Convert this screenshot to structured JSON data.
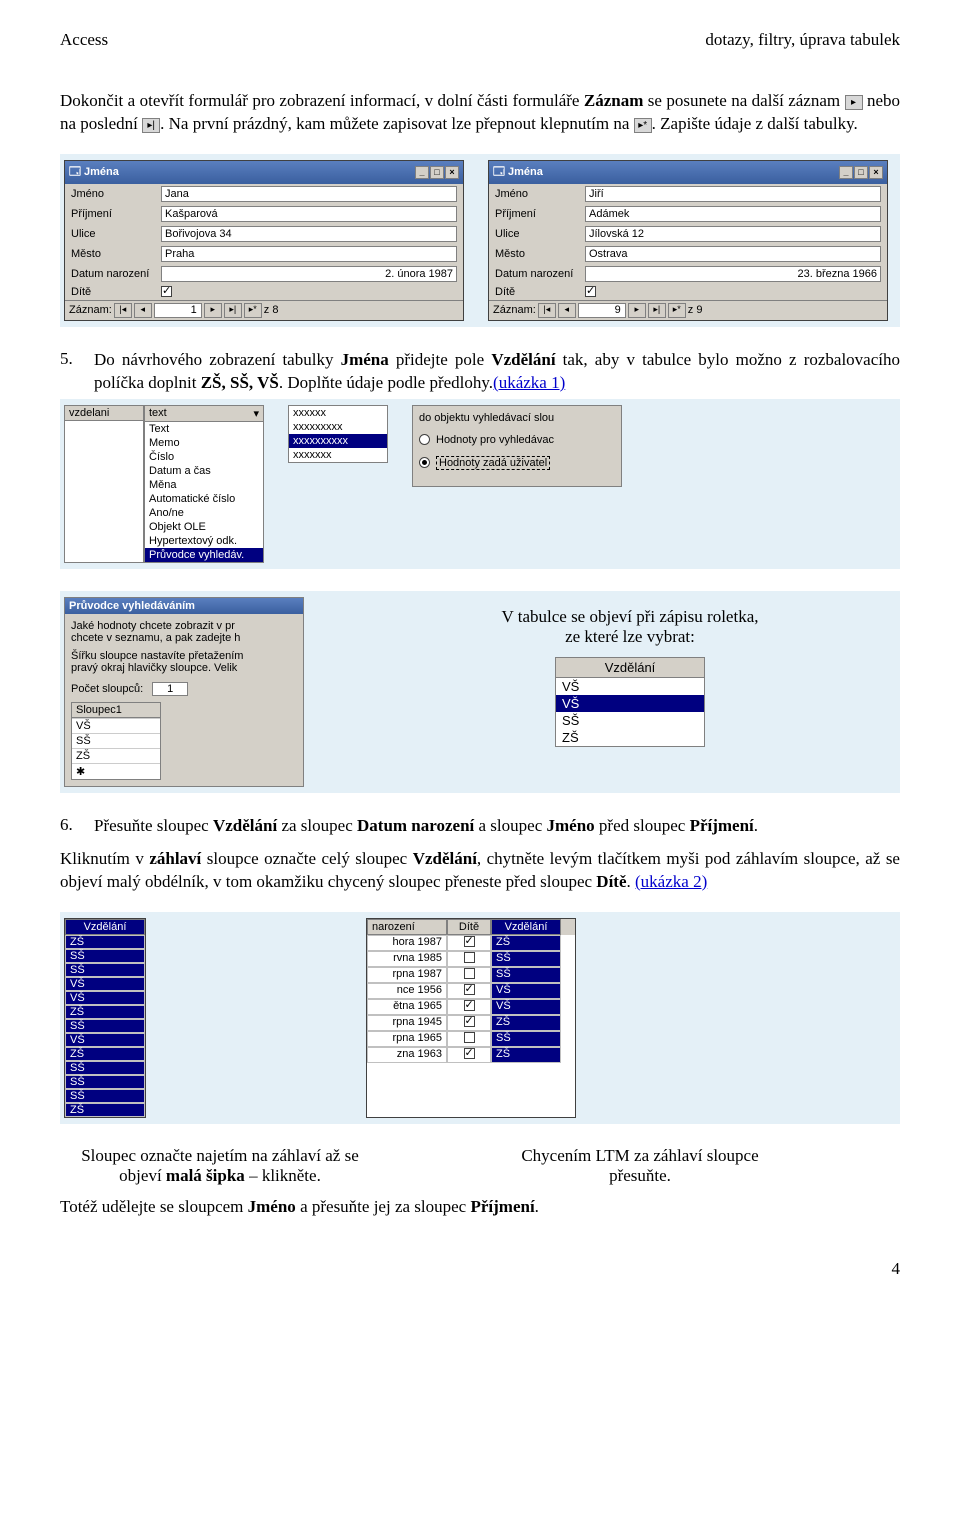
{
  "header": {
    "left": "Access",
    "right": "dotazy, filtry, úprava tabulek"
  },
  "intro": {
    "p1a": "Dokončit a otevřít formulář pro zobrazení informací, v dolní části formuláře ",
    "p1b": "Záznam",
    "p1c": " se posunete na další záznam ",
    "p1d": " nebo na poslední ",
    "p1e": ". Na první prázdný, kam můžete zapisovat lze přepnout klepnutím na ",
    "p1f": ". Zapište údaje z další tabulky."
  },
  "icons": {
    "next": "▸",
    "last": "▸|",
    "new": "▸*"
  },
  "forms": {
    "title": "Jména",
    "labels": {
      "jmeno": "Jméno",
      "prijmeni": "Příjmení",
      "ulice": "Ulice",
      "mesto": "Město",
      "datum": "Datum narození",
      "dite": "Dítě"
    },
    "left": {
      "jmeno": "Jana",
      "prijmeni": "Kašparová",
      "ulice": "Bořivojova 34",
      "mesto": "Praha",
      "datum": "2. února 1987",
      "rec": "1",
      "total": "z 8"
    },
    "right": {
      "jmeno": "Jiří",
      "prijmeni": "Adámek",
      "ulice": "Jílovská 12",
      "mesto": "Ostrava",
      "datum": "23. března 1966",
      "rec": "9",
      "total": "z 9"
    },
    "recnav_label": "Záznam:"
  },
  "task5": {
    "num": "5.",
    "text_a": "Do návrhového zobrazení tabulky ",
    "text_b": "Jména",
    "text_c": " přidejte pole ",
    "text_d": "Vzdělání",
    "text_e": " tak, aby v tabulce bylo možno z rozbalovacího políčka doplnit ",
    "text_f": "ZŠ, SŠ, VŠ",
    "text_g": ". Doplňte údaje podle předlohy.",
    "link": "(ukázka 1)"
  },
  "design": {
    "field": "vzdelani",
    "type": "text",
    "types": [
      "Text",
      "Memo",
      "Číslo",
      "Datum a čas",
      "Měna",
      "Automatické číslo",
      "Ano/ne",
      "Objekt OLE",
      "Hypertextový odk.",
      "Průvodce vyhledáv."
    ],
    "type_selected": "Průvodce vyhledáv."
  },
  "lookup_box": {
    "rows": [
      "xxxxxx",
      "xxxxxxxxx",
      "xxxxxxxxxx",
      "xxxxxxx"
    ],
    "selected": "xxxxxxxxxx"
  },
  "radio": {
    "head": "do objektu vyhledávací slou",
    "opt1": "Hodnoty pro vyhledávac",
    "opt2": "Hodnoty zadá uživatel"
  },
  "wizard": {
    "title": "Průvodce vyhledáváním",
    "l1": "Jaké hodnoty chcete zobrazit v pr",
    "l2": "chcete v seznamu, a pak zadejte h",
    "l3": "Šířku sloupce nastavíte přetažením",
    "l4": "pravý okraj hlavičky sloupce. Velik",
    "cols_label": "Počet sloupců:",
    "cols_val": "1",
    "col_head": "Sloupec1",
    "col_rows": [
      "VŠ",
      "SŠ",
      "ZŠ"
    ]
  },
  "roletka_caption_a": "V tabulce se objeví při zápisu roletka,",
  "roletka_caption_b": "ze které lze vybrat:",
  "roletka": {
    "head": "Vzdělání",
    "opts": [
      "VŠ",
      "VŠ",
      "SŠ",
      "ZŠ"
    ],
    "selected": 1
  },
  "task6": {
    "num": "6.",
    "a": "Přesuňte sloupec ",
    "b": "Vzdělání",
    "c": " za sloupec ",
    "d": "Datum narození",
    "e": " a sloupec ",
    "f": "Jméno",
    "g": " před sloupec ",
    "h": "Příjmení",
    "i": "."
  },
  "task6_para": {
    "a": "Kliknutím v ",
    "b": "záhlaví",
    "c": " sloupce označte celý sloupec ",
    "d": "Vzdělání",
    "e": ", chytněte levým tlačítkem myši pod záhlavím sloupce, až se objeví malý obdélník, v tom okamžiku chycený sloupec přeneste před sloupec ",
    "f": "Dítě",
    "g": ". ",
    "link": "(ukázka 2)"
  },
  "dsheet_left": {
    "head": "Vzdělání",
    "rows": [
      "ZŠ",
      "SŠ",
      "SŠ",
      "VŠ",
      "VŠ",
      "ZŠ",
      "SŠ",
      "VŠ",
      "ZŠ",
      "SŠ",
      "SŠ",
      "SŠ",
      "ZŠ"
    ]
  },
  "dsheet_right": {
    "heads": [
      "narození",
      "Dítě",
      "Vzdělání"
    ],
    "rows": [
      {
        "a": "hora 1987",
        "chk": true,
        "v": "ZŠ"
      },
      {
        "a": "rvna 1985",
        "chk": false,
        "v": "SŠ"
      },
      {
        "a": "rpna 1987",
        "chk": false,
        "v": "SŠ"
      },
      {
        "a": "nce 1956",
        "chk": true,
        "v": "VŠ"
      },
      {
        "a": "ětna 1965",
        "chk": true,
        "v": "VŠ"
      },
      {
        "a": "rpna 1945",
        "chk": true,
        "v": "ZŠ"
      },
      {
        "a": "rpna 1965",
        "chk": false,
        "v": "SŠ"
      },
      {
        "a": "zna 1963",
        "chk": true,
        "v": "ZŠ"
      }
    ]
  },
  "bottom_caps": {
    "left_a": "Sloupec označte najetím na záhlaví až se",
    "left_b": "objeví ",
    "left_c": "malá šipka",
    "left_d": " – klikněte.",
    "right_a": "Chycením LTM za záhlaví sloupce",
    "right_b": "přesuňte."
  },
  "last_line": {
    "a": "Totéž udělejte se sloupcem ",
    "b": "Jméno",
    "c": " a přesuňte jej za sloupec ",
    "d": "Příjmení",
    "e": "."
  },
  "pagenum": "4"
}
